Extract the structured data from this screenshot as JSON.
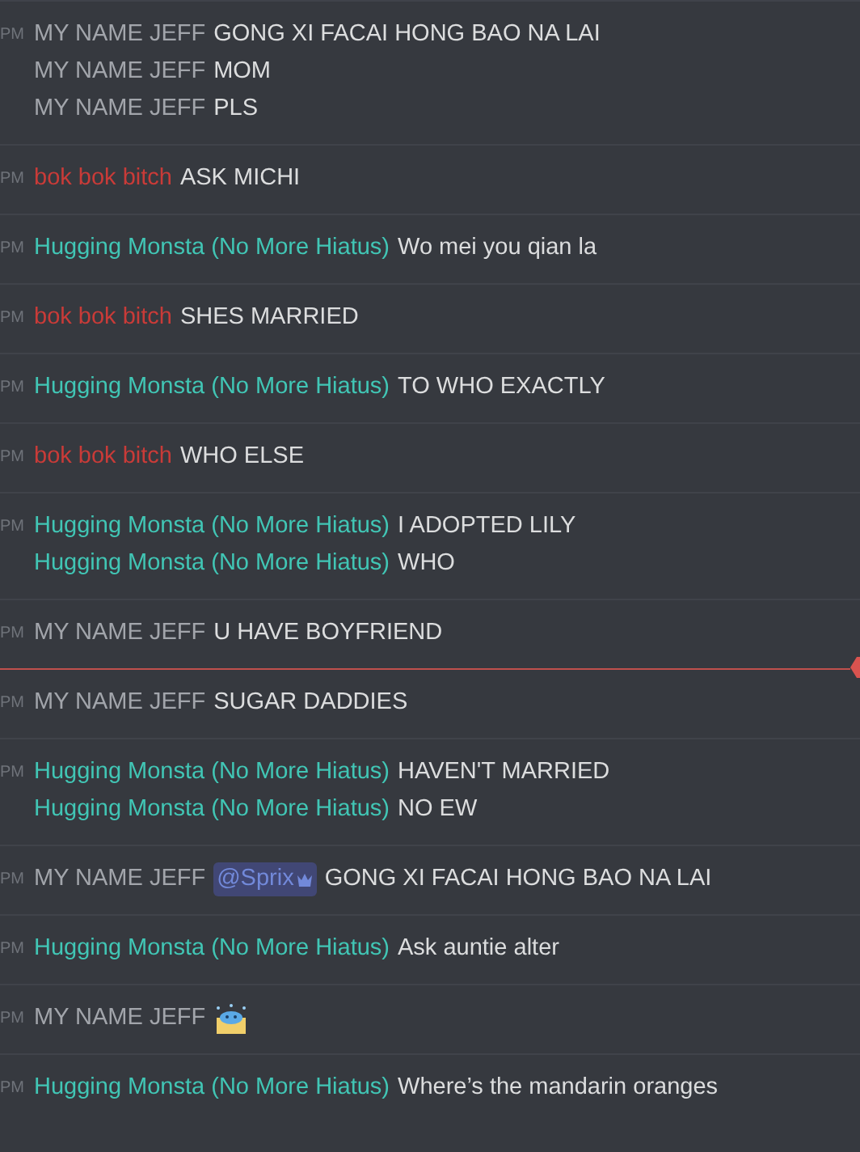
{
  "messages_groups": [
    {
      "time": "PM",
      "unread_divider": false,
      "messages": [
        {
          "author": "MY NAME JEFF",
          "color": "#a2a5ab",
          "text": "GONG XI FACAI HONG BAO NA LAI"
        },
        {
          "author": "MY NAME JEFF",
          "color": "#a2a5ab",
          "text": "MOM"
        },
        {
          "author": "MY NAME JEFF",
          "color": "#a2a5ab",
          "text": "PLS"
        }
      ]
    },
    {
      "time": "PM",
      "unread_divider": false,
      "messages": [
        {
          "author": "bok bok bitch",
          "color": "#c93b38",
          "text": "ASK MICHI"
        }
      ]
    },
    {
      "time": "PM",
      "unread_divider": false,
      "messages": [
        {
          "author": "Hugging Monsta (No More Hiatus)",
          "color": "#41c6b5",
          "text": "Wo mei you qian la"
        }
      ]
    },
    {
      "time": "PM",
      "unread_divider": false,
      "messages": [
        {
          "author": "bok bok bitch",
          "color": "#c93b38",
          "text": "SHES MARRIED"
        }
      ]
    },
    {
      "time": "PM",
      "unread_divider": false,
      "messages": [
        {
          "author": "Hugging Monsta (No More Hiatus)",
          "color": "#41c6b5",
          "text": "TO WHO EXACTLY"
        }
      ]
    },
    {
      "time": "PM",
      "unread_divider": false,
      "messages": [
        {
          "author": "bok bok bitch",
          "color": "#c93b38",
          "text": "WHO ELSE"
        }
      ]
    },
    {
      "time": "PM",
      "unread_divider": false,
      "messages": [
        {
          "author": "Hugging Monsta (No More Hiatus)",
          "color": "#41c6b5",
          "text": "I ADOPTED LILY"
        },
        {
          "author": "Hugging Monsta (No More Hiatus)",
          "color": "#41c6b5",
          "text": "WHO"
        }
      ]
    },
    {
      "time": "PM",
      "unread_divider": false,
      "messages": [
        {
          "author": "MY NAME JEFF",
          "color": "#a2a5ab",
          "text": "U HAVE BOYFRIEND"
        }
      ]
    },
    {
      "time": "PM",
      "unread_divider": true,
      "messages": [
        {
          "author": "MY NAME JEFF",
          "color": "#a2a5ab",
          "text": "SUGAR DADDIES"
        }
      ]
    },
    {
      "time": "PM",
      "unread_divider": false,
      "messages": [
        {
          "author": "Hugging Monsta (No More Hiatus)",
          "color": "#41c6b5",
          "text": "HAVEN'T MARRIED"
        },
        {
          "author": "Hugging Monsta (No More Hiatus)",
          "color": "#41c6b5",
          "text": "NO EW"
        }
      ]
    },
    {
      "time": "PM",
      "unread_divider": false,
      "messages": [
        {
          "author": "MY NAME JEFF",
          "color": "#a2a5ab",
          "parts": [
            {
              "kind": "mention",
              "text": "@Sprix"
            },
            {
              "kind": "text",
              "text": "GONG XI FACAI HONG BAO NA LAI"
            }
          ]
        }
      ]
    },
    {
      "time": "PM",
      "unread_divider": false,
      "messages": [
        {
          "author": "Hugging Monsta (No More Hiatus)",
          "color": "#41c6b5",
          "text": "Ask auntie alter"
        }
      ]
    },
    {
      "time": "PM",
      "unread_divider": false,
      "messages": [
        {
          "author": "MY NAME JEFF",
          "color": "#a2a5ab",
          "parts": [
            {
              "kind": "emoji"
            }
          ]
        }
      ]
    },
    {
      "time": "PM",
      "unread_divider": false,
      "messages": [
        {
          "author": "Hugging Monsta (No More Hiatus)",
          "color": "#41c6b5",
          "text": "Where’s the mandarin oranges"
        }
      ]
    }
  ]
}
